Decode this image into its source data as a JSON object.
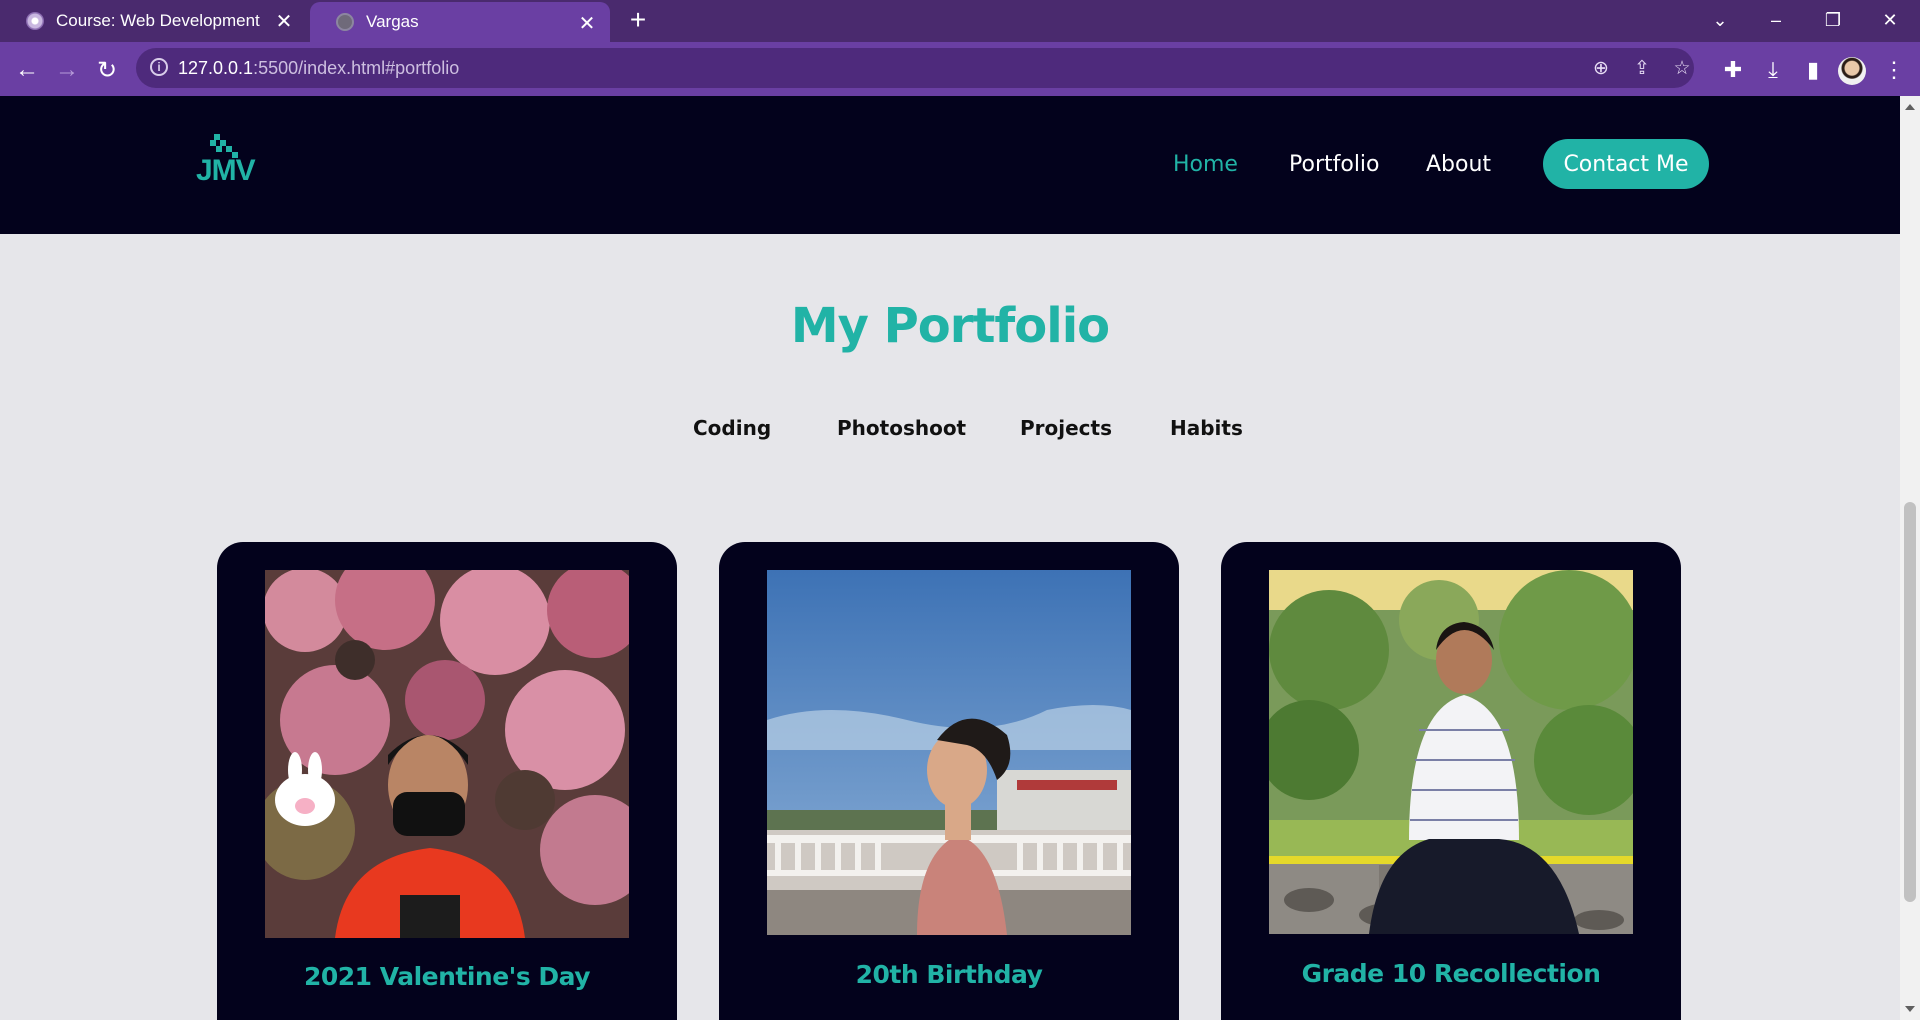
{
  "browser": {
    "tabs": [
      {
        "title": "Course: Web Development",
        "active": false
      },
      {
        "title": "Vargas",
        "active": true
      }
    ],
    "url_host": "127.0.0.1",
    "url_rest": ":5500/index.html#portfolio",
    "colors": {
      "frame": "#4a2a6e",
      "toolbar": "#6a3fa3",
      "omnibox": "#4e2a7c"
    }
  },
  "site": {
    "logo_text": "JMV",
    "nav": {
      "home": "Home",
      "portfolio": "Portfolio",
      "about": "About",
      "contact": "Contact Me"
    },
    "colors": {
      "accent": "#21b3a6",
      "dark": "#03021c",
      "background": "#e6e6ea"
    }
  },
  "portfolio": {
    "title": "My Portfolio",
    "filters": [
      "Coding",
      "Photoshoot",
      "Projects",
      "Habits"
    ],
    "cards": [
      {
        "caption": "2021 Valentine's Day"
      },
      {
        "caption": "20th Birthday"
      },
      {
        "caption": "Grade 10 Recollection"
      }
    ]
  }
}
